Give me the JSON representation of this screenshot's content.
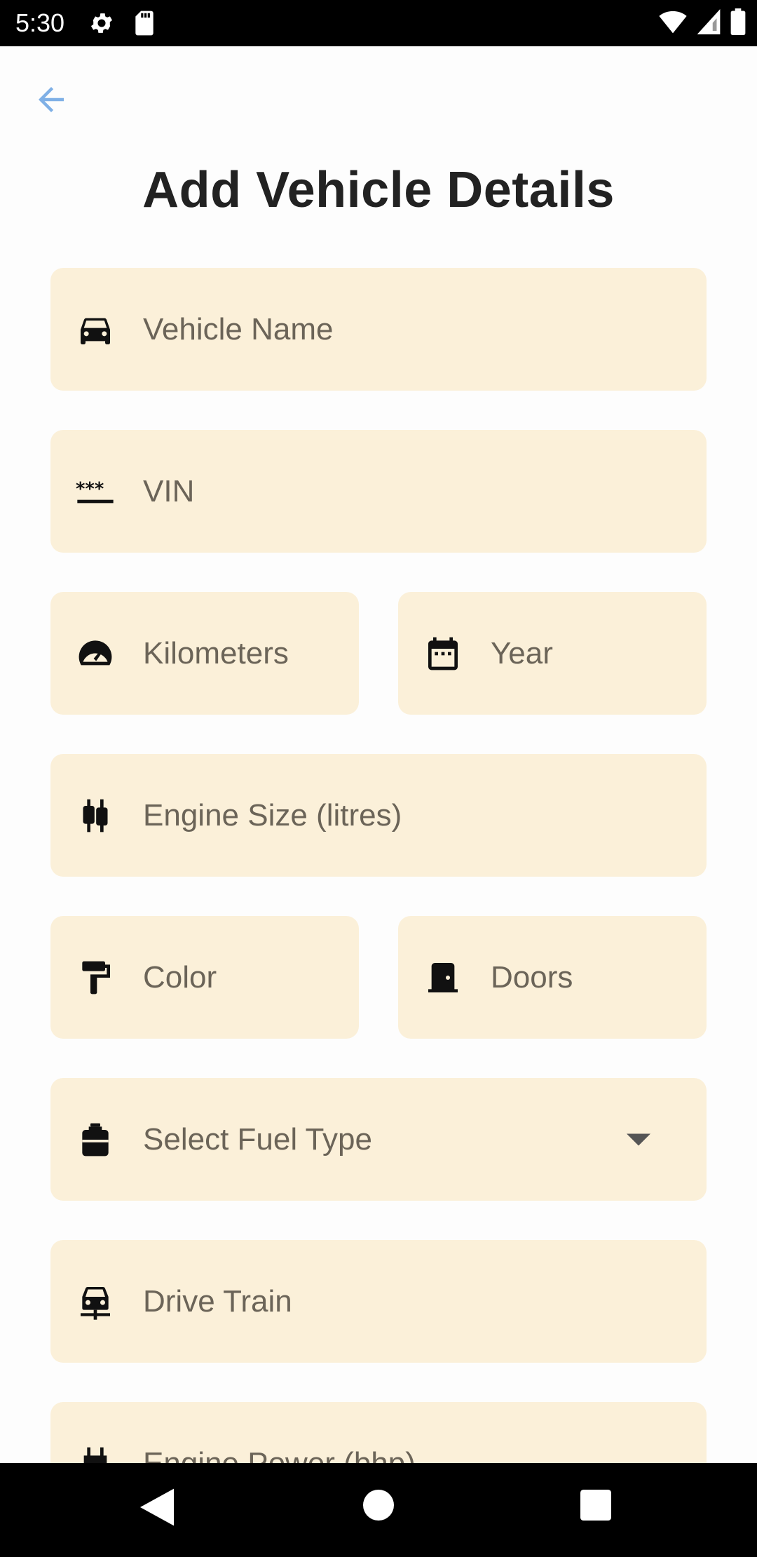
{
  "status_bar": {
    "time": "5:30",
    "icons": [
      "settings-icon",
      "sd-card-icon",
      "wifi-icon",
      "signal-icon",
      "battery-icon"
    ]
  },
  "header": {
    "back_icon": "arrow-back-icon",
    "title": "Add Vehicle Details"
  },
  "form": {
    "vehicle_name": {
      "placeholder": "Vehicle Name",
      "icon": "car-icon"
    },
    "vin": {
      "placeholder": "VIN",
      "icon": "password-icon"
    },
    "kilometers": {
      "placeholder": "Kilometers",
      "icon": "speedometer-icon"
    },
    "year": {
      "placeholder": "Year",
      "icon": "calendar-icon"
    },
    "engine_size": {
      "placeholder": "Engine Size (litres)",
      "icon": "engine-icon"
    },
    "color": {
      "placeholder": "Color",
      "icon": "paint-roller-icon"
    },
    "doors": {
      "placeholder": "Doors",
      "icon": "door-icon"
    },
    "fuel_type": {
      "placeholder": "Select Fuel Type",
      "icon": "fuel-can-icon"
    },
    "drive_train": {
      "placeholder": "Drive Train",
      "icon": "drive-train-icon"
    },
    "engine_power": {
      "placeholder": "Engine Power (bhp)",
      "icon": "plug-icon"
    }
  },
  "colors": {
    "field_bg": "#fbf0d9",
    "accent": "#7fb0e6"
  }
}
